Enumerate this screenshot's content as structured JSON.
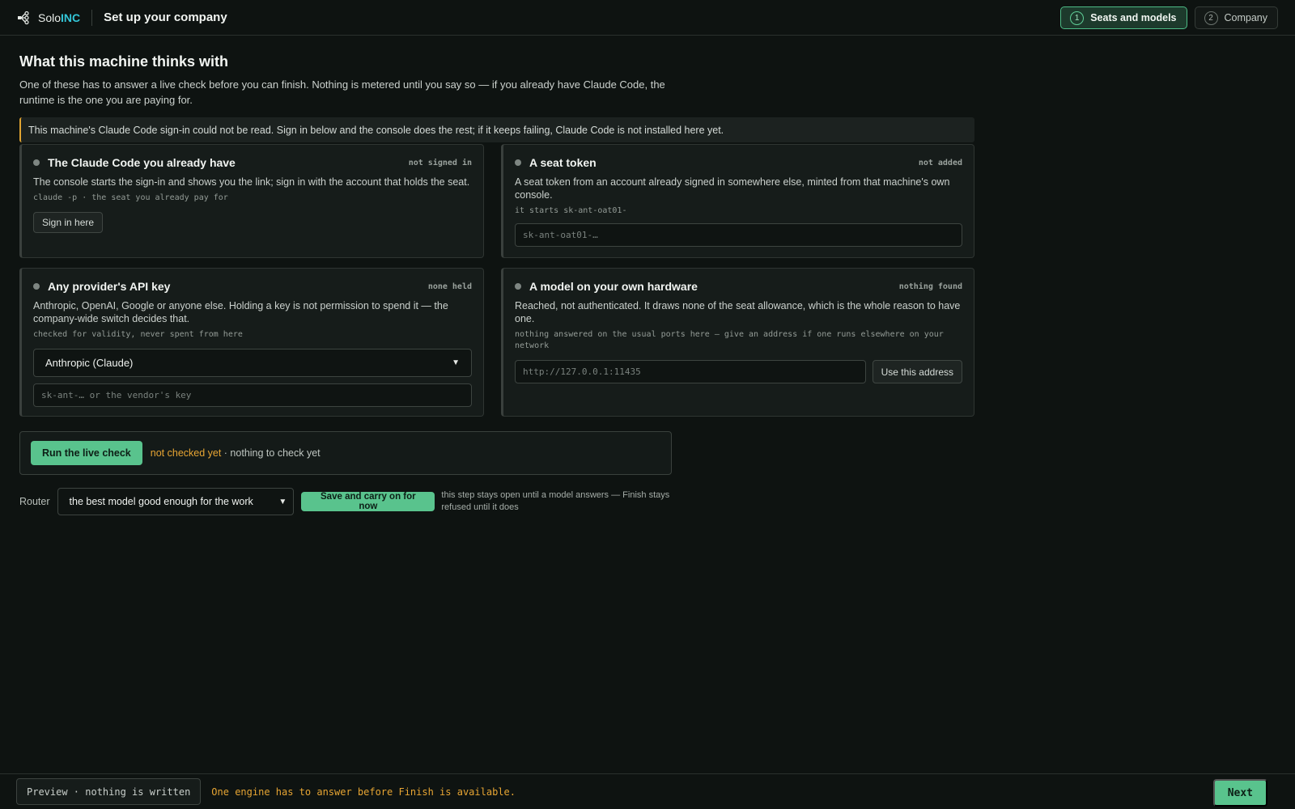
{
  "header": {
    "brand_prefix": "Solo",
    "brand_accent": "INC",
    "page_title": "Set up your company",
    "steps": [
      {
        "num": "1",
        "label": "Seats and models",
        "active": true
      },
      {
        "num": "2",
        "label": "Company",
        "active": false
      }
    ]
  },
  "main": {
    "heading": "What this machine thinks with",
    "intro": "One of these has to answer a live check before you can finish. Nothing is metered until you say so — if you already have Claude Code, the runtime is the one you are paying for.",
    "notice": "This machine's Claude Code sign-in could not be read. Sign in below and the console does the rest; if it keeps failing, Claude Code is not installed here yet."
  },
  "cards": {
    "claude_code": {
      "title": "The Claude Code you already have",
      "status": "not signed in",
      "description": "The console starts the sign-in and shows you the link; sign in with the account that holds the seat.",
      "note": "claude -p · the seat you already pay for",
      "button": "Sign in here"
    },
    "seat_token": {
      "title": "A seat token",
      "status": "not added",
      "description": "A seat token from an account already signed in somewhere else, minted from that machine's own console.",
      "note": "it starts sk-ant-oat01-",
      "placeholder": "sk-ant-oat01-…"
    },
    "api_key": {
      "title": "Any provider's API key",
      "status": "none held",
      "description": "Anthropic, OpenAI, Google or anyone else. Holding a key is not permission to spend it — the company-wide switch decides that.",
      "note": "checked for validity, never spent from here",
      "provider_selected": "Anthropic (Claude)",
      "placeholder": "sk-ant-… or the vendor's key"
    },
    "local_model": {
      "title": "A model on your own hardware",
      "status": "nothing found",
      "description": "Reached, not authenticated. It draws none of the seat allowance, which is the whole reason to have one.",
      "note": "nothing answered on the usual ports here — give an address if one runs elsewhere on your network",
      "placeholder": "http://127.0.0.1:11435",
      "button": "Use this address"
    }
  },
  "check": {
    "button": "Run the live check",
    "status_warn": "not checked yet",
    "status_rest": " · nothing to check yet"
  },
  "router": {
    "label": "Router",
    "selected": "the best model good enough for the work",
    "save_button": "Save and carry on for now",
    "help": "this step stays open until a model answers — Finish stays refused until it does"
  },
  "footer": {
    "preview": "Preview · nothing is written",
    "message": "One engine has to answer before Finish is available.",
    "next": "Next"
  },
  "colors": {
    "accent_green": "#59c38d",
    "warning_amber": "#e7a533",
    "brand_cyan": "#33c6d8",
    "background": "#0e1311"
  }
}
